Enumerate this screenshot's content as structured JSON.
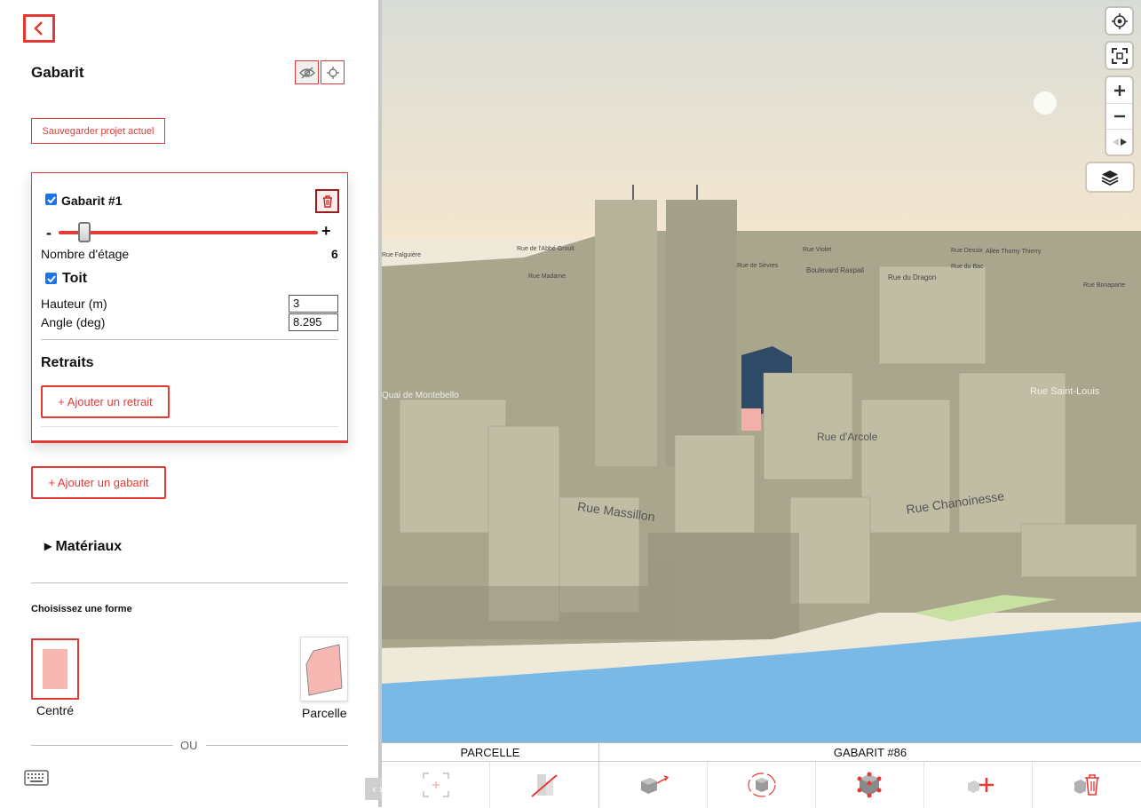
{
  "sidebar": {
    "title": "Gabarit",
    "save_label": "Sauvegarder projet actuel",
    "gabarit": {
      "name": "Gabarit #1",
      "minus": "-",
      "plus": "+",
      "floors_label": "Nombre d'étage",
      "floors_value": "6",
      "floors_fraction": 0.1,
      "roof_label": "Toit",
      "height_label": "Hauteur (m)",
      "height_value": "3",
      "angle_label": "Angle (deg)",
      "angle_value": "8.295",
      "retraits_title": "Retraits",
      "add_retrait_label": "+ Ajouter un retrait"
    },
    "add_gabarit_label": "+ Ajouter un gabarit",
    "materials_label": "▸ Matériaux",
    "shape_title": "Choisissez une forme",
    "shape_center_label": "Centré",
    "shape_parcel_label": "Parcelle",
    "or_label": "OU",
    "toggle_label": "‹ ›"
  },
  "map": {
    "streets": [
      "Rue de l'Abbé Groult",
      "Rue Falguière",
      "Rue Madame",
      "Rue Violet",
      "Boulevard Raspail",
      "Rue du Dragon",
      "Rue Dessix",
      "Allée Thomy Thierry",
      "Rue du Bac",
      "Rue Bonaparte",
      "Rue de Sèvres",
      "Quai de Montebello",
      "Rue Massillon",
      "Rue d'Arcole",
      "Rue Chanoinesse",
      "Rue Saint-Louis"
    ],
    "colors": {
      "water": "#7ab8e6",
      "building": "#b7b39b",
      "sky": "#dfe0da",
      "selected": "#f3b0aa",
      "highlight": "#2e4a66"
    }
  },
  "bottom_bar": {
    "parcel_label": "PARCELLE",
    "gabarit_label": "GABARIT #86",
    "tools": [
      "select-frame-icon",
      "no-building-icon",
      "move-volume-icon",
      "rotate-volume-icon",
      "vertex-edit-icon",
      "add-volume-icon",
      "delete-volume-icon"
    ]
  }
}
